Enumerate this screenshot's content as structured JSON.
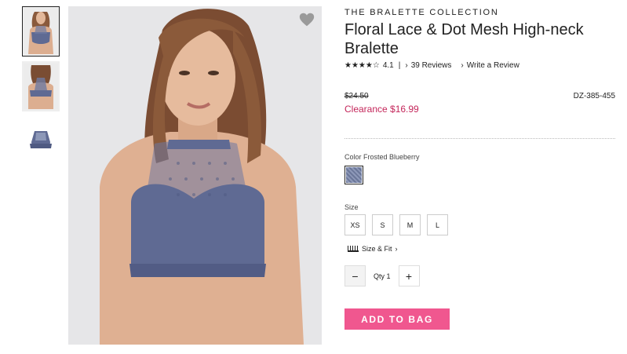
{
  "product": {
    "collection": "THE BRALETTE COLLECTION",
    "title": "Floral Lace & Dot Mesh High-neck Bralette",
    "rating": {
      "stars": "★★★★☆",
      "value": "4.1",
      "separator": "|",
      "reviews": "39 Reviews",
      "write_review": "Write a Review",
      "chevron": "›"
    },
    "price": {
      "original": "$24.50",
      "clearance": "Clearance $16.99",
      "sku": "DZ-385-455"
    },
    "color": {
      "label": "Color Frosted Blueberry"
    },
    "size": {
      "label": "Size",
      "options": [
        "XS",
        "S",
        "M",
        "L"
      ]
    },
    "size_fit": "Size & Fit",
    "quantity": {
      "label": "Qty 1",
      "minus": "−",
      "plus": "+"
    },
    "add_to_bag": "ADD TO BAG"
  },
  "gallery": {
    "thumbnail_count": 3,
    "selected_index": 0
  },
  "colors": {
    "accent": "#f0578f",
    "sale": "#c4265a",
    "bra": "#5f6a93"
  },
  "icons": [
    "heart-icon",
    "ruler-icon",
    "chevron-right-icon",
    "star-icon"
  ]
}
